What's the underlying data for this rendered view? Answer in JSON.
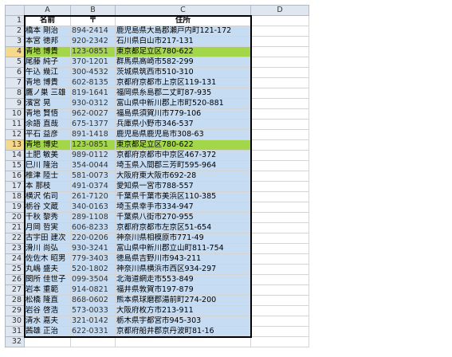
{
  "columns": [
    "A",
    "B",
    "C",
    "D"
  ],
  "header": {
    "name": "名前",
    "zip": "〒",
    "address": "住所"
  },
  "rows": [
    {
      "n": 2,
      "name": "橋本 剛治",
      "zip": "894-2414",
      "addr": "鹿児島県大島郡瀬戸内町121-172",
      "hl": false
    },
    {
      "n": 3,
      "name": "本宮 徳邦",
      "zip": "920-2342",
      "addr": "石川県白山市217-131",
      "hl": false
    },
    {
      "n": 4,
      "name": "青地 博貴",
      "zip": "123-0851",
      "addr": "東京都足立区780-622",
      "hl": true
    },
    {
      "n": 5,
      "name": "尾藤 純子",
      "zip": "370-1201",
      "addr": "群馬県高崎市582-299",
      "hl": false
    },
    {
      "n": 6,
      "name": "午込 幾江",
      "zip": "300-4532",
      "addr": "茨城県筑西市510-310",
      "hl": false
    },
    {
      "n": 7,
      "name": "青地 博貴",
      "zip": "602-8135",
      "addr": "京都府京都市上京区119-131",
      "hl": false
    },
    {
      "n": 8,
      "name": "鷹ノ巣 三雄",
      "zip": "819-1641",
      "addr": "福岡県糸島郡二丈町87-935",
      "hl": false
    },
    {
      "n": 9,
      "name": "濱宮 晃",
      "zip": "930-0312",
      "addr": "富山県中新川郡上市町520-881",
      "hl": false
    },
    {
      "n": 10,
      "name": "青地 賢悟",
      "zip": "962-0027",
      "addr": "福島県須賀川市779-106",
      "hl": false
    },
    {
      "n": 11,
      "name": "余語 直哉",
      "zip": "675-1377",
      "addr": "兵庫県小野市346-537",
      "hl": false
    },
    {
      "n": 12,
      "name": "平石 益彦",
      "zip": "891-1418",
      "addr": "鹿児島県鹿児島市308-63",
      "hl": false
    },
    {
      "n": 13,
      "name": "青地 博史",
      "zip": "123-0851",
      "addr": "東京都足立区780-622",
      "hl": true
    },
    {
      "n": 14,
      "name": "土肥 敏美",
      "zip": "989-0112",
      "addr": "京都府京都市中京区467-372",
      "hl": false
    },
    {
      "n": 15,
      "name": "巳川 隆治",
      "zip": "354-0044",
      "addr": "埼玉県入間郡三芳町595-964",
      "hl": false
    },
    {
      "n": 16,
      "name": "椎津 陸士",
      "zip": "581-0073",
      "addr": "大阪府東大阪市692-28",
      "hl": false
    },
    {
      "n": 17,
      "name": "本 那枝",
      "zip": "491-0374",
      "addr": "愛知県一宮市788-557",
      "hl": false
    },
    {
      "n": 18,
      "name": "横沢 佑司",
      "zip": "261-7120",
      "addr": "千葉県千葉市美浜区110-385",
      "hl": false
    },
    {
      "n": 19,
      "name": "栃谷 文蔵",
      "zip": "340-0163",
      "addr": "埼玉県幸手市334-947",
      "hl": false
    },
    {
      "n": 20,
      "name": "千秋 黎秀",
      "zip": "289-1108",
      "addr": "千葉県八街市270-955",
      "hl": false
    },
    {
      "n": 21,
      "name": "月岡 哲実",
      "zip": "606-8233",
      "addr": "京都府京都市左京区51-654",
      "hl": false
    },
    {
      "n": 22,
      "name": "古宇田 建次",
      "zip": "220-0206",
      "addr": "神奈川県相模原市771-49",
      "hl": false
    },
    {
      "n": 23,
      "name": "滑川 尚弘",
      "zip": "930-3241",
      "addr": "富山県中新川郡立山町811-754",
      "hl": false
    },
    {
      "n": 24,
      "name": "佐佐木 昭男",
      "zip": "779-3403",
      "addr": "徳島県吉野川市943-211",
      "hl": false
    },
    {
      "n": 25,
      "name": "丸嶋 盛夫",
      "zip": "520-1802",
      "addr": "神奈川県横浜市西区934-297",
      "hl": false
    },
    {
      "n": 26,
      "name": "関所 佳世子",
      "zip": "099-3504",
      "addr": "北海道網走市553-849",
      "hl": false
    },
    {
      "n": 27,
      "name": "岩本 重範",
      "zip": "914-0821",
      "addr": "福井県敦賀市197-879",
      "hl": false
    },
    {
      "n": 28,
      "name": "松橋 隆直",
      "zip": "868-0602",
      "addr": "熊本県球磨郡湯前町274-200",
      "hl": false
    },
    {
      "n": 29,
      "name": "岩谷 啓浩",
      "zip": "573-0033",
      "addr": "大阪府枚方市213-911",
      "hl": false
    },
    {
      "n": 30,
      "name": "清水 嘉夫",
      "zip": "321-0142",
      "addr": "栃木県宇都宮市945-303",
      "hl": false
    },
    {
      "n": 31,
      "name": "茜雄 正治",
      "zip": "622-0331",
      "addr": "京都府船井郡京丹波町81-16",
      "hl": false
    }
  ],
  "header_row_number": 1,
  "empty_row_number": 32,
  "selected_rows": [
    4,
    13
  ],
  "colors": {
    "cell_blue": "#c6dcf3",
    "highlight_green": "#a4d64a",
    "header_gray": "#dfe6ef",
    "selected_header": "#f5d88a"
  }
}
